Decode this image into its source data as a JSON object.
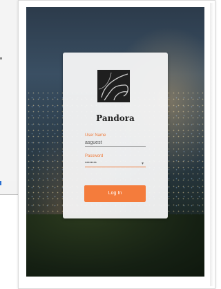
{
  "app": {
    "title": "Pandora"
  },
  "login": {
    "username_label": "User Name",
    "username_value": "asguest",
    "password_label": "Password",
    "password_value": "••••••••",
    "submit_label": "Log In"
  },
  "colors": {
    "accent": "#f47c3c",
    "label": "#ee7a3a"
  },
  "icons": {
    "logo": "pandora-logo-icon",
    "scroll_arrow": "scroll-down-arrow-icon",
    "password_reveal": "dropdown-caret-icon"
  }
}
